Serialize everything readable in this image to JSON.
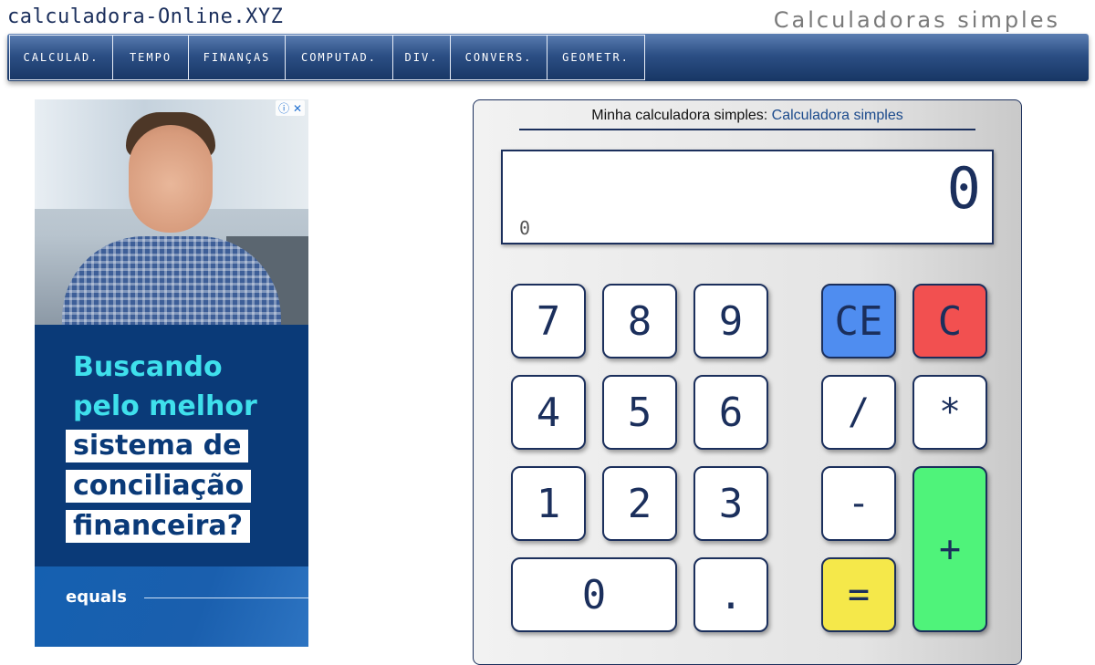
{
  "header": {
    "site_title": "calculadora-Online.XYZ",
    "subtitle": "Calculadoras simples"
  },
  "nav": {
    "items": [
      "CALCULAD.",
      "TEMPO",
      "FINANÇAS",
      "COMPUTAD.",
      "DIV.",
      "CONVERS.",
      "GEOMETR."
    ]
  },
  "ad": {
    "info_icon": "ⓘ",
    "close_icon": "✕",
    "lines": [
      "Buscando",
      "pelo melhor",
      "sistema de",
      "conciliação",
      "financeira?"
    ],
    "brand": "equals",
    "colors": {
      "background": "#0a3a78",
      "headline": "#3fe0ec"
    }
  },
  "calculator": {
    "heading_prefix": "Minha calculadora simples: ",
    "heading_link": "Calculadora simples",
    "display_value": "0",
    "history_value": "0",
    "keys": {
      "k7": "7",
      "k8": "8",
      "k9": "9",
      "k4": "4",
      "k5": "5",
      "k6": "6",
      "k1": "1",
      "k2": "2",
      "k3": "3",
      "k0": "0",
      "dot": ".",
      "ce": "CE",
      "c": "C",
      "div": "/",
      "mul": "*",
      "sub": "-",
      "add": "+",
      "eq": "="
    },
    "colors": {
      "ce": "#4f8df0",
      "c": "#f25050",
      "eq": "#f5e84a",
      "add": "#4ff37a"
    }
  }
}
